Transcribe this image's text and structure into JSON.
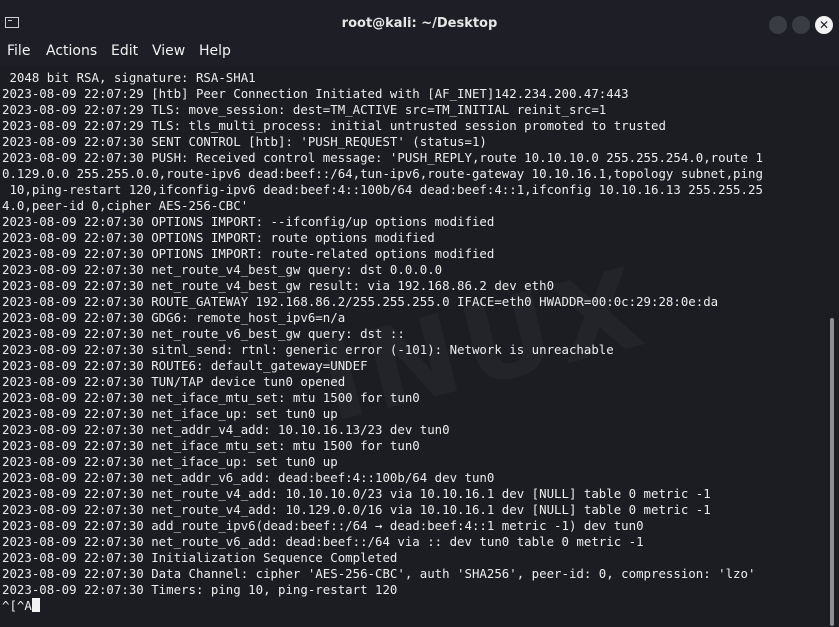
{
  "window": {
    "title": "root@kali: ~/Desktop",
    "icon": "terminal-icon",
    "close_glyph": "✕"
  },
  "menu": [
    "File",
    "Actions",
    "Edit",
    "View",
    "Help"
  ],
  "terminal": {
    "watermark": "INUX",
    "lines": [
      " 2048 bit RSA, signature: RSA-SHA1",
      "2023-08-09 22:07:29 [htb] Peer Connection Initiated with [AF_INET]142.234.200.47:443",
      "2023-08-09 22:07:29 TLS: move_session: dest=TM_ACTIVE src=TM_INITIAL reinit_src=1",
      "2023-08-09 22:07:29 TLS: tls_multi_process: initial untrusted session promoted to trusted",
      "2023-08-09 22:07:30 SENT CONTROL [htb]: 'PUSH_REQUEST' (status=1)",
      "2023-08-09 22:07:30 PUSH: Received control message: 'PUSH_REPLY,route 10.10.10.0 255.255.254.0,route 1",
      "0.129.0.0 255.255.0.0,route-ipv6 dead:beef::/64,tun-ipv6,route-gateway 10.10.16.1,topology subnet,ping",
      " 10,ping-restart 120,ifconfig-ipv6 dead:beef:4::100b/64 dead:beef:4::1,ifconfig 10.10.16.13 255.255.25",
      "4.0,peer-id 0,cipher AES-256-CBC'",
      "2023-08-09 22:07:30 OPTIONS IMPORT: --ifconfig/up options modified",
      "2023-08-09 22:07:30 OPTIONS IMPORT: route options modified",
      "2023-08-09 22:07:30 OPTIONS IMPORT: route-related options modified",
      "2023-08-09 22:07:30 net_route_v4_best_gw query: dst 0.0.0.0",
      "2023-08-09 22:07:30 net_route_v4_best_gw result: via 192.168.86.2 dev eth0",
      "2023-08-09 22:07:30 ROUTE_GATEWAY 192.168.86.2/255.255.255.0 IFACE=eth0 HWADDR=00:0c:29:28:0e:da",
      "2023-08-09 22:07:30 GDG6: remote_host_ipv6=n/a",
      "2023-08-09 22:07:30 net_route_v6_best_gw query: dst ::",
      "2023-08-09 22:07:30 sitnl_send: rtnl: generic error (-101): Network is unreachable",
      "2023-08-09 22:07:30 ROUTE6: default_gateway=UNDEF",
      "2023-08-09 22:07:30 TUN/TAP device tun0 opened",
      "2023-08-09 22:07:30 net_iface_mtu_set: mtu 1500 for tun0",
      "2023-08-09 22:07:30 net_iface_up: set tun0 up",
      "2023-08-09 22:07:30 net_addr_v4_add: 10.10.16.13/23 dev tun0",
      "2023-08-09 22:07:30 net_iface_mtu_set: mtu 1500 for tun0",
      "2023-08-09 22:07:30 net_iface_up: set tun0 up",
      "2023-08-09 22:07:30 net_addr_v6_add: dead:beef:4::100b/64 dev tun0",
      "2023-08-09 22:07:30 net_route_v4_add: 10.10.10.0/23 via 10.10.16.1 dev [NULL] table 0 metric -1",
      "2023-08-09 22:07:30 net_route_v4_add: 10.129.0.0/16 via 10.10.16.1 dev [NULL] table 0 metric -1",
      "2023-08-09 22:07:30 add_route_ipv6(dead:beef::/64 → dead:beef:4::1 metric -1) dev tun0",
      "2023-08-09 22:07:30 net_route_v6_add: dead:beef::/64 via :: dev tun0 table 0 metric -1",
      "2023-08-09 22:07:30 Initialization Sequence Completed",
      "2023-08-09 22:07:30 Data Channel: cipher 'AES-256-CBC', auth 'SHA256', peer-id: 0, compression: 'lzo'",
      "2023-08-09 22:07:30 Timers: ping 10, ping-restart 120"
    ],
    "prompt": "^[^A"
  }
}
